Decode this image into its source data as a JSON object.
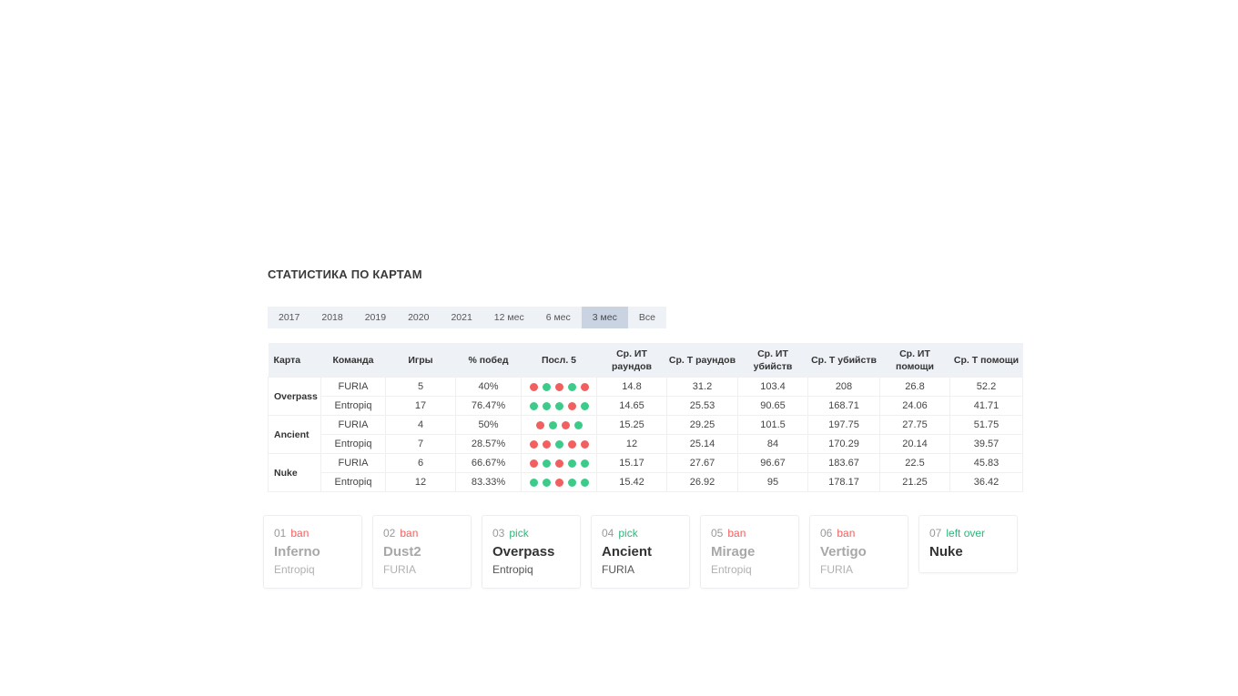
{
  "section": {
    "title": "СТАТИСТИКА ПО КАРТАМ"
  },
  "filters": {
    "tabs": [
      "2017",
      "2018",
      "2019",
      "2020",
      "2021",
      "12 мес",
      "6 мес",
      "3 мес",
      "Все"
    ],
    "active": "3 мес"
  },
  "table": {
    "headers": [
      "Карта",
      "Команда",
      "Игры",
      "% побед",
      "Посл. 5",
      "Ср. ИТ раундов",
      "Ср. Т раундов",
      "Ср. ИТ убийств",
      "Ср. Т убийств",
      "Ср. ИТ помощи",
      "Ср. Т помощи"
    ],
    "maps": [
      {
        "name": "Overpass",
        "rows": [
          {
            "team": "FURIA",
            "games": "5",
            "win_pct": "40%",
            "last5": [
              "L",
              "W",
              "L",
              "W",
              "L"
            ],
            "ct_rounds": "14.8",
            "t_rounds": "31.2",
            "ct_kills": "103.4",
            "t_kills": "208",
            "ct_assists": "26.8",
            "t_assists": "52.2"
          },
          {
            "team": "Entropiq",
            "games": "17",
            "win_pct": "76.47%",
            "last5": [
              "W",
              "W",
              "W",
              "L",
              "W"
            ],
            "ct_rounds": "14.65",
            "t_rounds": "25.53",
            "ct_kills": "90.65",
            "t_kills": "168.71",
            "ct_assists": "24.06",
            "t_assists": "41.71"
          }
        ]
      },
      {
        "name": "Ancient",
        "rows": [
          {
            "team": "FURIA",
            "games": "4",
            "win_pct": "50%",
            "last5": [
              "L",
              "W",
              "L",
              "W"
            ],
            "ct_rounds": "15.25",
            "t_rounds": "29.25",
            "ct_kills": "101.5",
            "t_kills": "197.75",
            "ct_assists": "27.75",
            "t_assists": "51.75"
          },
          {
            "team": "Entropiq",
            "games": "7",
            "win_pct": "28.57%",
            "last5": [
              "L",
              "L",
              "W",
              "L",
              "L"
            ],
            "ct_rounds": "12",
            "t_rounds": "25.14",
            "ct_kills": "84",
            "t_kills": "170.29",
            "ct_assists": "20.14",
            "t_assists": "39.57"
          }
        ]
      },
      {
        "name": "Nuke",
        "rows": [
          {
            "team": "FURIA",
            "games": "6",
            "win_pct": "66.67%",
            "last5": [
              "L",
              "W",
              "L",
              "W",
              "W"
            ],
            "ct_rounds": "15.17",
            "t_rounds": "27.67",
            "ct_kills": "96.67",
            "t_kills": "183.67",
            "ct_assists": "22.5",
            "t_assists": "45.83"
          },
          {
            "team": "Entropiq",
            "games": "12",
            "win_pct": "83.33%",
            "last5": [
              "W",
              "W",
              "L",
              "W",
              "W"
            ],
            "ct_rounds": "15.42",
            "t_rounds": "26.92",
            "ct_kills": "95",
            "t_kills": "178.17",
            "ct_assists": "21.25",
            "t_assists": "36.42"
          }
        ]
      }
    ]
  },
  "veto": [
    {
      "num": "01",
      "action": "ban",
      "map": "Inferno",
      "team": "Entropiq"
    },
    {
      "num": "02",
      "action": "ban",
      "map": "Dust2",
      "team": "FURIA"
    },
    {
      "num": "03",
      "action": "pick",
      "map": "Overpass",
      "team": "Entropiq"
    },
    {
      "num": "04",
      "action": "pick",
      "map": "Ancient",
      "team": "FURIA"
    },
    {
      "num": "05",
      "action": "ban",
      "map": "Mirage",
      "team": "Entropiq"
    },
    {
      "num": "06",
      "action": "ban",
      "map": "Vertigo",
      "team": "FURIA"
    },
    {
      "num": "07",
      "action": "left over",
      "map": "Nuke",
      "team": ""
    }
  ],
  "colors": {
    "win": "#3dcb8a",
    "loss": "#f15f5f",
    "pick": "#2fb57b",
    "ban": "#f15f5f"
  }
}
